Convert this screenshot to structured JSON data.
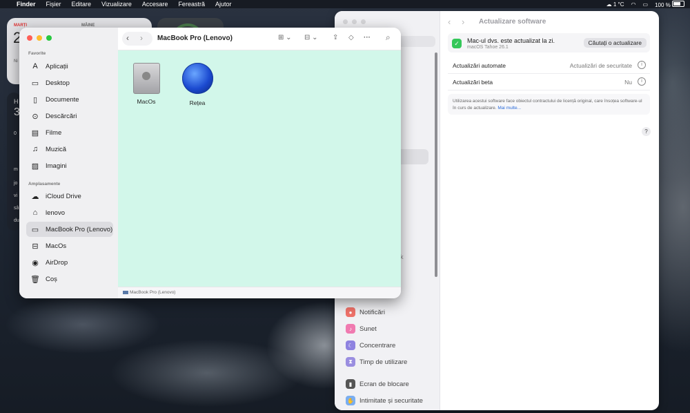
{
  "menubar": {
    "apple": "",
    "items": [
      "Finder",
      "Fișier",
      "Editare",
      "Vizualizare",
      "Accesare",
      "Fereastră",
      "Ajutor"
    ],
    "temperature": "1 °C",
    "battery": "100 %"
  },
  "widgets": {
    "calendar": {
      "day_label": "MARȚI",
      "next_label": "MÂINE",
      "date": "2",
      "note": "Ni"
    },
    "side_letters": [
      "H",
      "3",
      "0",
      "m",
      "jo",
      "vi",
      "sâ",
      "du"
    ]
  },
  "settings": {
    "title": "Actualizare software",
    "nav_back": "‹",
    "nav_forward": "›",
    "status_title": "Mac-ul dvs. este actualizat la zi.",
    "status_subtitle": "macOS Tahoe 26.1",
    "check_button": "Căutați o actualizare",
    "rows": [
      {
        "label": "Actualizări automate",
        "value": "Actualizări de securitate"
      },
      {
        "label": "Actualizări beta",
        "value": "Nu"
      }
    ],
    "info_glyph": "i",
    "legal_text": "Utilizarea acestui software face obiectul contractului de licență original, care însoțea software-ul în curs de actualizare.",
    "legal_link": "Mai multe...",
    "help": "?",
    "sidebar_peek": "k",
    "sidebar": [
      {
        "label": "Notificări",
        "color": "#f0726a"
      },
      {
        "label": "Sunet",
        "color": "#f07ab0"
      },
      {
        "label": "Concentrare",
        "color": "#8e82e0"
      },
      {
        "label": "Timp de utilizare",
        "color": "#9a8ee0"
      },
      {
        "label": "Ecran de blocare",
        "color": "#555555"
      },
      {
        "label": "Intimitate și securitate",
        "color": "#7aaef0"
      }
    ]
  },
  "finder": {
    "title": "MacBook Pro (Lenovo)",
    "section_favorites": "Favorite",
    "section_locations": "Amplasamente",
    "favorites": [
      {
        "label": "Aplicații",
        "icon": "A"
      },
      {
        "label": "Desktop",
        "icon": "▭"
      },
      {
        "label": "Documente",
        "icon": "▯"
      },
      {
        "label": "Descărcări",
        "icon": "⊙"
      },
      {
        "label": "Filme",
        "icon": "▤"
      },
      {
        "label": "Muzică",
        "icon": "♫"
      },
      {
        "label": "Imagini",
        "icon": "▨"
      }
    ],
    "locations": [
      {
        "label": "iCloud Drive",
        "icon": "☁"
      },
      {
        "label": "lenovo",
        "icon": "⌂"
      },
      {
        "label": "MacBook Pro (Lenovo)",
        "icon": "▭"
      },
      {
        "label": "MacOs",
        "icon": "⊟"
      },
      {
        "label": "AirDrop",
        "icon": "◉"
      },
      {
        "label": "Coș",
        "icon": "🗑"
      }
    ],
    "files": [
      {
        "label": "MacOs"
      },
      {
        "label": "Rețea"
      }
    ],
    "toolbar": {
      "back": "‹",
      "forward": "›",
      "view": "⊞ ⌄",
      "group": "⊟ ⌄",
      "share": "⇪",
      "tag": "◇",
      "more": "···",
      "search": "⌕"
    },
    "status_path": "MacBook Pro (Lenovo)"
  },
  "colors": {
    "finder_bg": "#d2f7ea",
    "accent_link": "#2a6ad8",
    "check_green": "#34c759"
  }
}
